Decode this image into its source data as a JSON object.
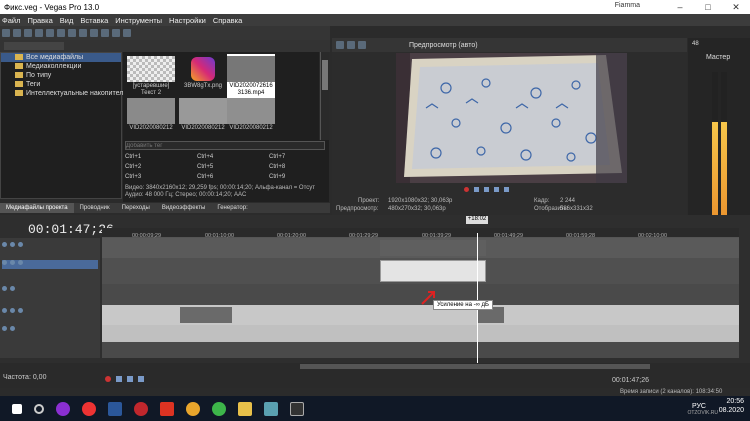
{
  "window": {
    "title": "Фикс.veg - Vegas Pro 13.0",
    "user": "Fiamma"
  },
  "menu": [
    "Файл",
    "Правка",
    "Вид",
    "Вставка",
    "Инструменты",
    "Настройки",
    "Справка"
  ],
  "explorer": {
    "tree": [
      "Все медиафайлы",
      "Медиаколлекции",
      "По типу",
      "Теги",
      "Интеллектуальные накопители"
    ],
    "thumbs": [
      {
        "label": "[устаревшие] Текст 2"
      },
      {
        "label": "3BW8gTx.png"
      },
      {
        "label": "VID2020072616 3136.mp4"
      },
      {
        "label": "VID2020080212"
      },
      {
        "label": "VID2020080212"
      },
      {
        "label": "VID2020080212"
      }
    ],
    "filter_placeholder": "Добавить тег",
    "shortcuts": [
      "Ctrl+1",
      "Ctrl+4",
      "Ctrl+7",
      "Ctrl+2",
      "Ctrl+5",
      "Ctrl+8",
      "Ctrl+3",
      "Ctrl+6",
      "Ctrl+9"
    ],
    "info_video": "Видео: 3840x2160x12; 29,259 fps; 00:00:14;20; Альфа-канал = Отсут",
    "info_audio": "Аудио: 48 000 Гц; Стерео; 00:00:14;20; AAC"
  },
  "tabs": [
    "Медиафайлы проекта",
    "Проводник",
    "Переходы",
    "Видеоэффекты",
    "Генератор:"
  ],
  "preview": {
    "mode": "Предпросмотр (авто)",
    "project_label": "Проект:",
    "project_value": "1920x1080x32; 30,063p",
    "preview_label": "Предпросмотр:",
    "preview_value": "480x270x32; 30,063p",
    "frame_label": "Кадр:",
    "frame_value": "2 244",
    "display_label": "Отобразить:",
    "display_value": "586x331x32"
  },
  "master": {
    "title": "Мастер",
    "value": "48"
  },
  "timeline": {
    "timecode": "00:01:47;26",
    "marker": "+18:02",
    "ticks": [
      "00:00:09;29",
      "00:01:10;00",
      "00:01:20;00",
      "00:01:29;29",
      "00:01:39;29",
      "00:01:49;29",
      "00:01:59;28",
      "00:02:10;00"
    ],
    "tooltip": "Усиление на -∞ дБ"
  },
  "transport": {
    "rate": "Частота: 0,00",
    "timecode": "00:01:47;26",
    "rec": "Время записи (2 каналов): 108:34:50"
  },
  "taskbar": {
    "lang": "РУС",
    "time": "20:56",
    "date": "08.2020",
    "watermark": "OTZOVIK.RU"
  }
}
